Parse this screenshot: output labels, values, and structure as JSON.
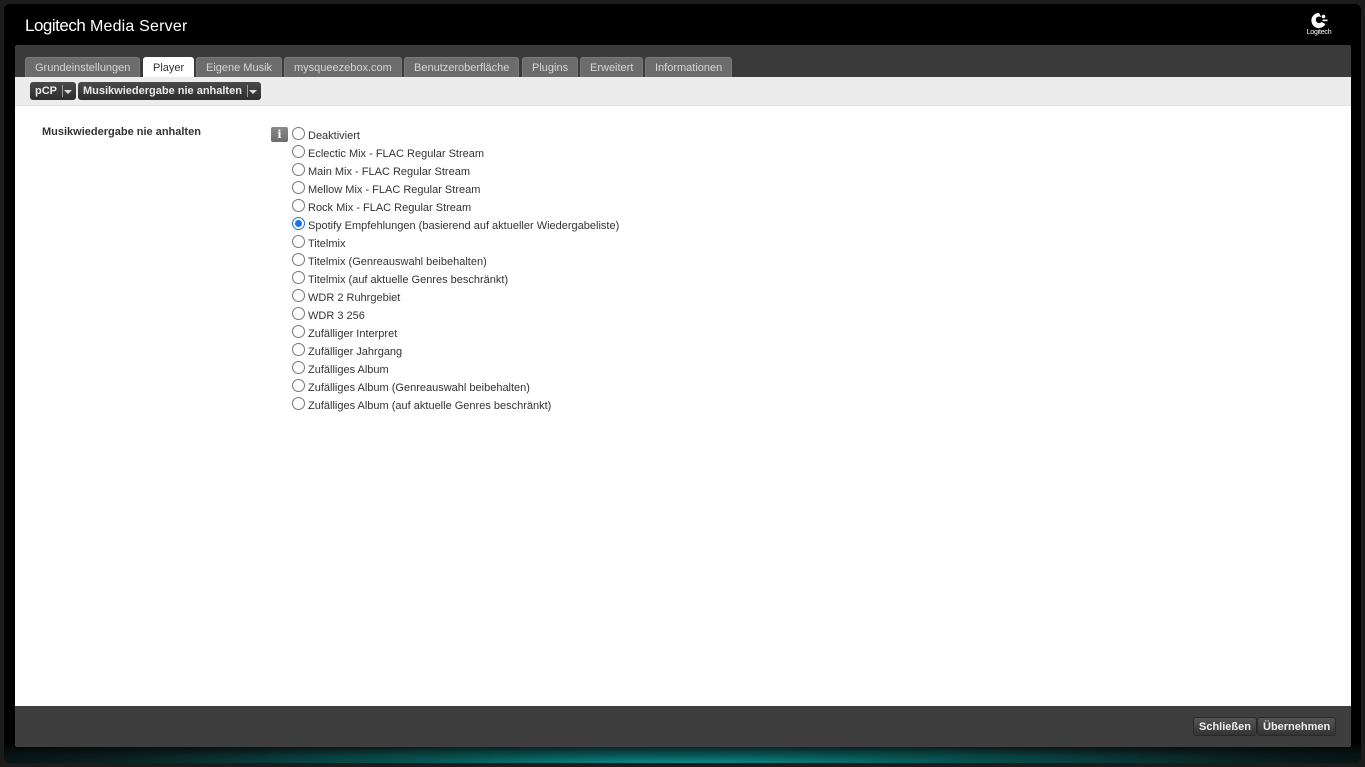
{
  "app": {
    "brand_logi": "Logitech",
    "brand_rest": "Media Server",
    "logo_text": "Logitech"
  },
  "tabs": [
    {
      "label": "Grundeinstellungen",
      "active": false
    },
    {
      "label": "Player",
      "active": true
    },
    {
      "label": "Eigene Musik",
      "active": false
    },
    {
      "label": "mysqueezebox.com",
      "active": false
    },
    {
      "label": "Benutzeroberfläche",
      "active": false
    },
    {
      "label": "Plugins",
      "active": false
    },
    {
      "label": "Erweitert",
      "active": false
    },
    {
      "label": "Informationen",
      "active": false
    }
  ],
  "subbar": {
    "player_select": "pCP",
    "page_select": "Musikwiedergabe nie anhalten"
  },
  "setting": {
    "label": "Musikwiedergabe nie anhalten",
    "info_icon": "i",
    "selected_index": 5,
    "options": [
      "Deaktiviert",
      "Eclectic Mix - FLAC Regular Stream",
      "Main Mix - FLAC Regular Stream",
      "Mellow Mix - FLAC Regular Stream",
      "Rock Mix - FLAC Regular Stream",
      "Spotify Empfehlungen (basierend auf aktueller Wiedergabeliste)",
      "Titelmix",
      "Titelmix (Genreauswahl beibehalten)",
      "Titelmix (auf aktuelle Genres beschränkt)",
      "WDR 2 Ruhrgebiet",
      "WDR 3 256",
      "Zufälliger Interpret",
      "Zufälliger Jahrgang",
      "Zufälliges Album",
      "Zufälliges Album (Genreauswahl beibehalten)",
      "Zufälliges Album (auf aktuelle Genres beschränkt)"
    ]
  },
  "footer": {
    "close_label": "Schließen",
    "apply_label": "Übernehmen"
  },
  "colors": {
    "radio_selected": "#1a73e8",
    "tab_inactive": "#6c6c6c",
    "footer_bg": "#3e3e3e"
  }
}
